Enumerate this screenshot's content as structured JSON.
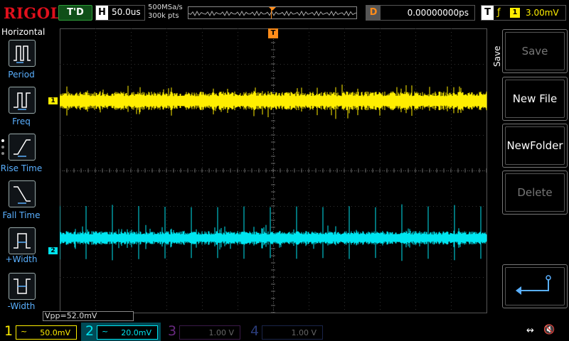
{
  "header": {
    "brand": "RIGOL",
    "trigger_status": "T'D",
    "timebase_label": "H",
    "timebase_value": "50.0us",
    "sample_rate": "500MSa/s",
    "memory_depth": "300k pts",
    "delay_label": "D",
    "delay_value": "0.00000000ps",
    "trigger_label": "T",
    "trigger_source": "1",
    "trigger_level": "3.00mV"
  },
  "left_menu": {
    "title": "Horizontal",
    "items": [
      {
        "label": "Period",
        "icon": "period-icon"
      },
      {
        "label": "Freq",
        "icon": "freq-icon"
      },
      {
        "label": "Rise Time",
        "icon": "rise-time-icon"
      },
      {
        "label": "Fall Time",
        "icon": "fall-time-icon"
      },
      {
        "label": "+Width",
        "icon": "pos-width-icon"
      },
      {
        "label": "-Width",
        "icon": "neg-width-icon"
      }
    ]
  },
  "right_menu": {
    "title": "Save",
    "buttons": [
      {
        "label": "Save",
        "enabled": false
      },
      {
        "label": "New File",
        "enabled": true
      },
      {
        "label": "NewFolder",
        "enabled": true
      },
      {
        "label": "Delete",
        "enabled": false
      },
      {
        "label": "",
        "icon": "enter-return-icon",
        "enabled": true
      }
    ]
  },
  "markers": {
    "ch1": "1",
    "ch2": "2",
    "trigger_position": "T"
  },
  "measurement": {
    "text": "Vpp=52.0mV"
  },
  "channels": [
    {
      "num": "1",
      "coupling": "~",
      "scale": "50.0mV",
      "color": "#ffee00",
      "active": true
    },
    {
      "num": "2",
      "coupling": "~",
      "scale": "20.0mV",
      "color": "#00e5f0",
      "active": true
    },
    {
      "num": "3",
      "coupling": "",
      "scale": "1.00 V",
      "color": "#c83cff",
      "active": false
    },
    {
      "num": "4",
      "coupling": "",
      "scale": "1.00 V",
      "color": "#3a6cff",
      "active": false
    }
  ],
  "status_icons": [
    "usb-icon",
    "sound-mute-icon"
  ],
  "colors": {
    "ch1": "#ffee00",
    "ch2": "#00e5f0",
    "trigger": "#ff8c1a",
    "brand": "#e0101c",
    "menu_label": "#5ab0ff"
  }
}
